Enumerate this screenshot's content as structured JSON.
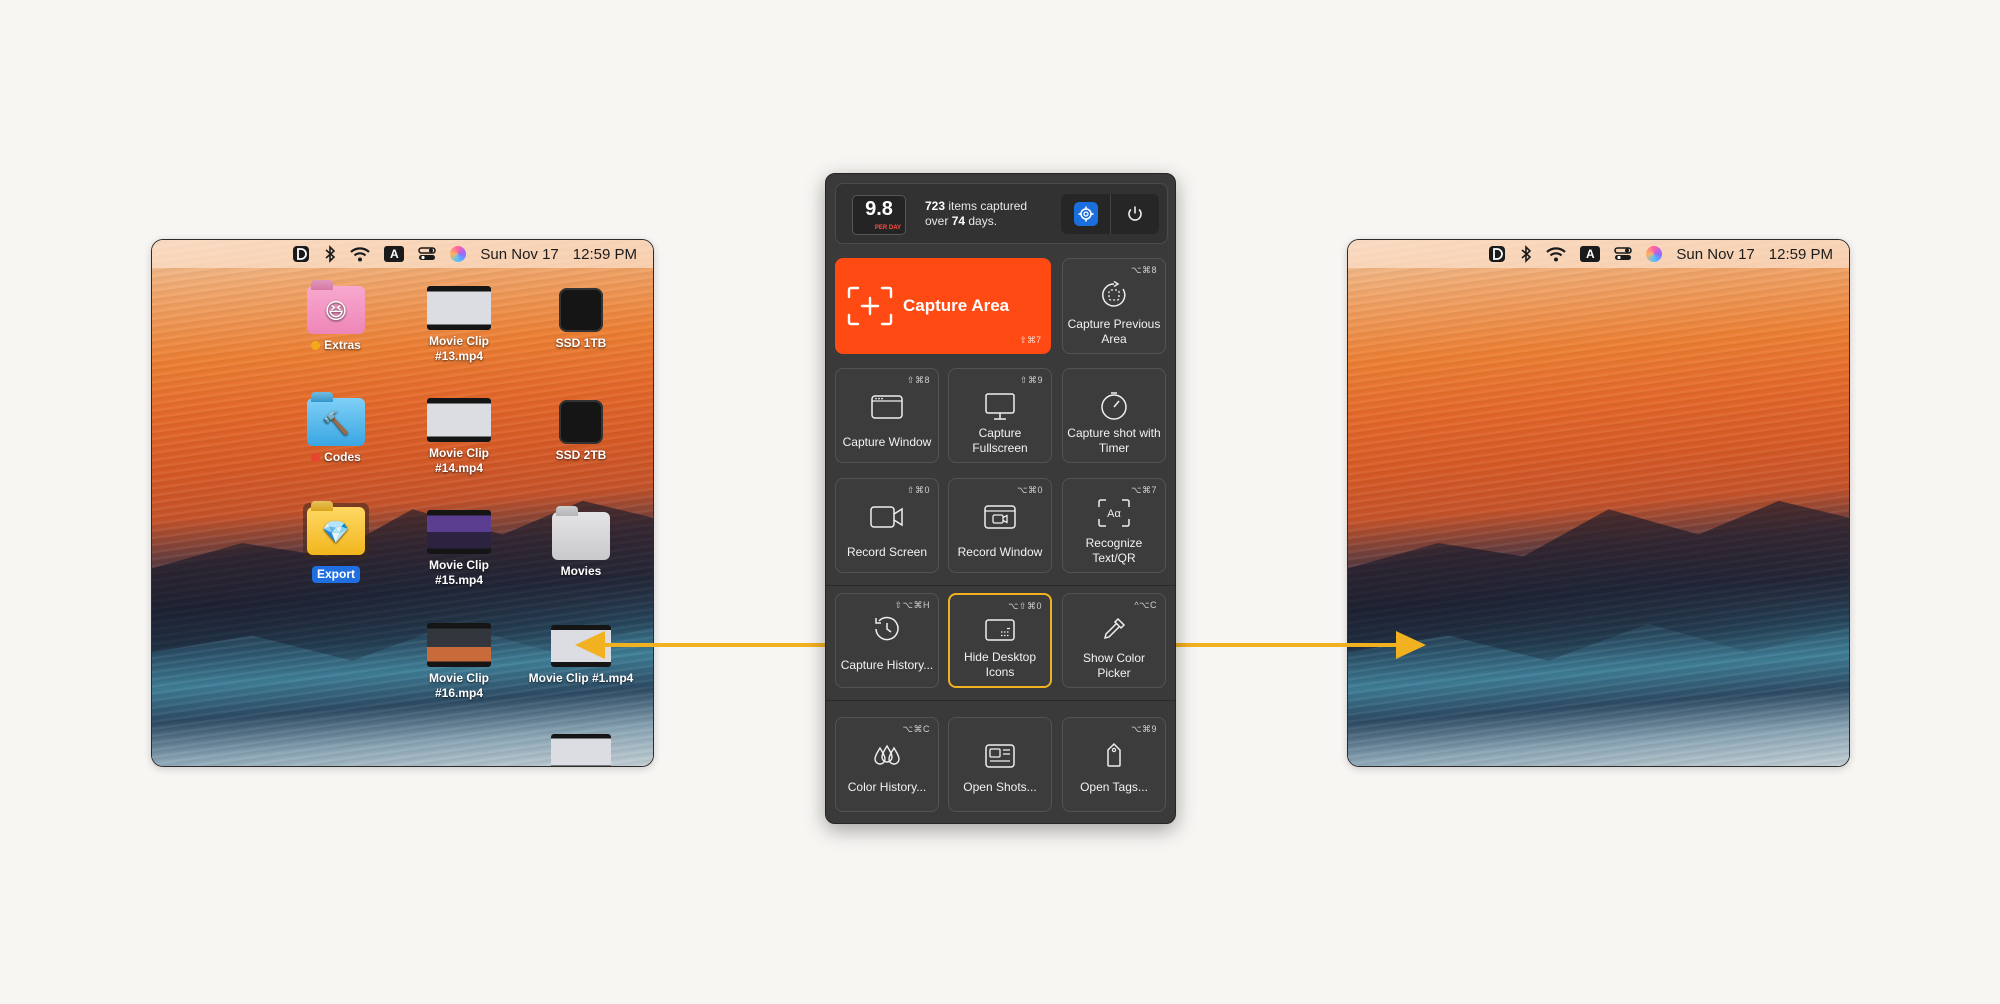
{
  "menubar": {
    "date": "Sun Nov 17",
    "time": "12:59 PM",
    "icons": [
      "dashlane-icon",
      "bluetooth-icon",
      "wifi-icon",
      "input-source-icon",
      "control-center-icon",
      "siri-icon"
    ],
    "input_source": "A"
  },
  "desktop_left": {
    "icons": [
      {
        "label": "Extras",
        "kind": "folder-pink",
        "tag_color": "#f2a91a"
      },
      {
        "label": "Movie Clip #13.mp4",
        "kind": "video"
      },
      {
        "label": "SSD 1TB",
        "kind": "drive"
      },
      {
        "label": "Codes",
        "kind": "folder-blue",
        "tag_color": "#e8452e"
      },
      {
        "label": "Movie Clip #14.mp4",
        "kind": "video"
      },
      {
        "label": "SSD 2TB",
        "kind": "drive"
      },
      {
        "label": "Export",
        "kind": "folder-yellow",
        "selected": true
      },
      {
        "label": "Movie Clip #15.mp4",
        "kind": "video"
      },
      {
        "label": "Movies",
        "kind": "folder-grey"
      },
      {
        "label": "Movie Clip #16.mp4",
        "kind": "video"
      },
      {
        "label": "Movie Clip #1.mp4",
        "kind": "video"
      }
    ]
  },
  "panel": {
    "rate": {
      "value": "9.8",
      "unit": "PER DAY"
    },
    "stats": {
      "count": "723",
      "text1": " items captured",
      "prefix2": "over ",
      "days": "74",
      "text2": " days."
    },
    "capture_area": {
      "label": "Capture Area",
      "shortcut": "⇧⌘7"
    },
    "tiles": [
      {
        "id": "capture-previous-area",
        "label": "Capture Previous Area",
        "shortcut": "⌥⌘8",
        "icon": "previous-area-icon"
      },
      {
        "id": "capture-window",
        "label": "Capture Window",
        "shortcut": "⇧⌘8",
        "icon": "window-icon"
      },
      {
        "id": "capture-fullscreen",
        "label": "Capture Fullscreen",
        "shortcut": "⇧⌘9",
        "icon": "monitor-icon"
      },
      {
        "id": "capture-shot-with-timer",
        "label": "Capture shot with Timer",
        "shortcut": "",
        "icon": "timer-icon"
      },
      {
        "id": "record-screen",
        "label": "Record Screen",
        "shortcut": "⇧⌘0",
        "icon": "video-camera-icon"
      },
      {
        "id": "record-window",
        "label": "Record Window",
        "shortcut": "⌥⌘0",
        "icon": "record-window-icon"
      },
      {
        "id": "recognize-text-qr",
        "label": "Recognize Text/QR",
        "shortcut": "⌥⌘7",
        "icon": "text-recognition-icon"
      },
      {
        "id": "capture-history",
        "label": "Capture History...",
        "shortcut": "⇧⌥⌘H",
        "icon": "history-icon"
      },
      {
        "id": "hide-desktop-icons",
        "label": "Hide Desktop Icons",
        "shortcut": "⌥⇧⌘0",
        "icon": "hide-desktop-icon",
        "active": true
      },
      {
        "id": "show-color-picker",
        "label": "Show Color Picker",
        "shortcut": "^⌥C",
        "icon": "eyedropper-icon"
      },
      {
        "id": "color-history",
        "label": "Color History...",
        "shortcut": "⌥⌘C",
        "icon": "color-drops-icon"
      },
      {
        "id": "open-shots",
        "label": "Open Shots...",
        "shortcut": "",
        "icon": "shots-icon"
      },
      {
        "id": "open-tags",
        "label": "Open Tags...",
        "shortcut": "⌥⌘9",
        "icon": "tag-icon"
      }
    ]
  },
  "colors": {
    "accent_orange": "#ff4a13",
    "highlight_yellow": "#f2b121",
    "settings_blue": "#1b6fdc"
  }
}
